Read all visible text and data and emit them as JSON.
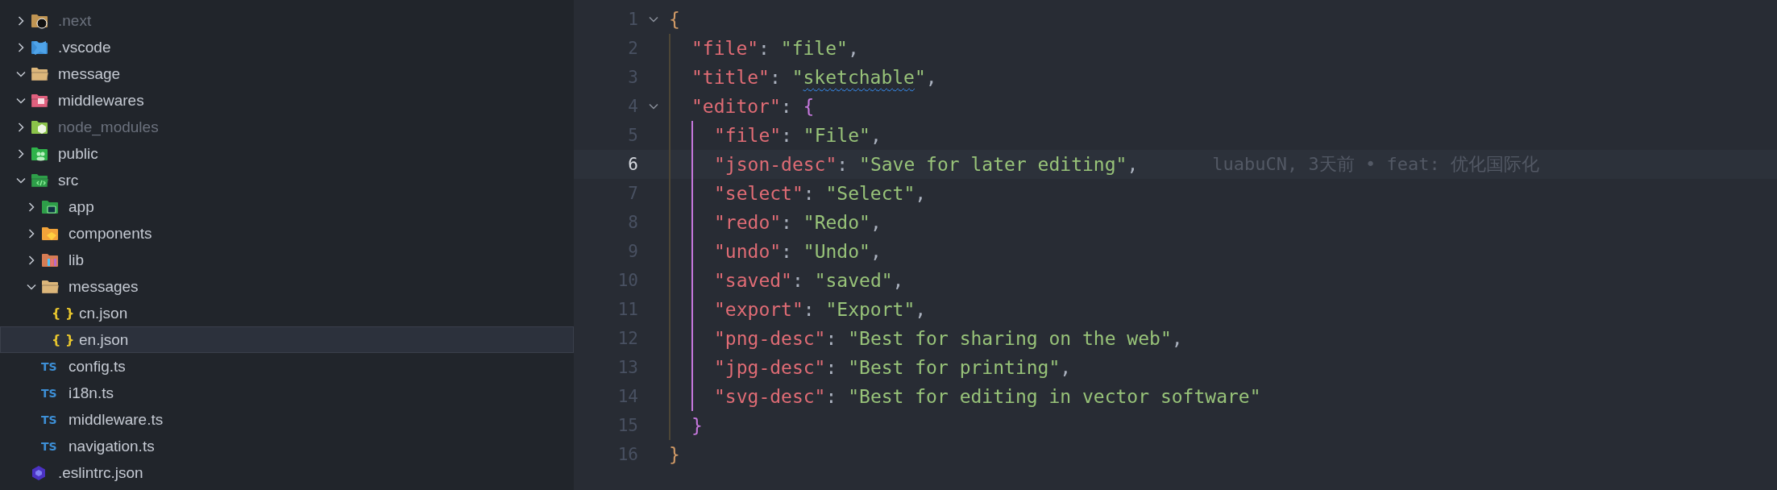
{
  "explorer": {
    "items": [
      {
        "label": ".next",
        "kind": "folder_next",
        "expanded": false,
        "dimmed": true,
        "selected": false
      },
      {
        "label": ".vscode",
        "kind": "folder_vscode",
        "expanded": false,
        "dimmed": false,
        "selected": false
      },
      {
        "label": "message",
        "kind": "folder",
        "expanded": true,
        "dimmed": false,
        "selected": false
      },
      {
        "label": "middlewares",
        "kind": "folder_middleware",
        "expanded": true,
        "dimmed": false,
        "selected": false
      },
      {
        "label": "node_modules",
        "kind": "folder_node",
        "expanded": false,
        "dimmed": true,
        "selected": false
      },
      {
        "label": "public",
        "kind": "folder_public",
        "expanded": false,
        "dimmed": false,
        "selected": false
      },
      {
        "label": "src",
        "kind": "folder_src",
        "expanded": true,
        "dimmed": false,
        "selected": false,
        "children": [
          {
            "label": "app",
            "kind": "folder_app",
            "expanded": false,
            "dimmed": false,
            "selected": false
          },
          {
            "label": "components",
            "kind": "folder_components",
            "expanded": false,
            "dimmed": false,
            "selected": false
          },
          {
            "label": "lib",
            "kind": "folder_lib",
            "expanded": false,
            "dimmed": false,
            "selected": false
          },
          {
            "label": "messages",
            "kind": "folder",
            "expanded": true,
            "dimmed": false,
            "selected": false,
            "children": [
              {
                "label": "cn.json",
                "kind": "json",
                "badge": "{ }",
                "dimmed": false,
                "selected": false
              },
              {
                "label": "en.json",
                "kind": "json",
                "badge": "{ }",
                "dimmed": false,
                "selected": true
              }
            ]
          },
          {
            "label": "config.ts",
            "kind": "ts",
            "badge": "TS",
            "dimmed": false,
            "selected": false
          },
          {
            "label": "i18n.ts",
            "kind": "ts",
            "badge": "TS",
            "dimmed": false,
            "selected": false
          },
          {
            "label": "middleware.ts",
            "kind": "ts",
            "badge": "TS",
            "dimmed": false,
            "selected": false
          },
          {
            "label": "navigation.ts",
            "kind": "ts",
            "badge": "TS",
            "dimmed": false,
            "selected": false
          }
        ]
      },
      {
        "label": ".eslintrc.json",
        "kind": "eslint",
        "dimmed": false,
        "selected": false
      }
    ]
  },
  "editor": {
    "lines": [
      {
        "number": "1",
        "current": false,
        "foldable": true,
        "expanded": true,
        "tokens": [
          {
            "kind": "open",
            "text": "{"
          }
        ]
      },
      {
        "number": "2",
        "current": false,
        "tokens": [
          {
            "kind": "key",
            "text": "\"file\""
          },
          {
            "kind": "punct",
            "text": ": "
          },
          {
            "kind": "string",
            "text": "\"file\""
          },
          {
            "kind": "punct",
            "text": ","
          }
        ]
      },
      {
        "number": "3",
        "current": false,
        "tokens": [
          {
            "kind": "key",
            "text": "\"title\""
          },
          {
            "kind": "punct",
            "text": ": "
          },
          {
            "kind": "string",
            "text": "\""
          },
          {
            "kind": "string",
            "text": "sketchable",
            "warning": true
          },
          {
            "kind": "string",
            "text": "\""
          },
          {
            "kind": "punct",
            "text": ","
          }
        ]
      },
      {
        "number": "4",
        "current": false,
        "foldable": true,
        "expanded": true,
        "tokens": [
          {
            "kind": "key",
            "text": "\"editor\""
          },
          {
            "kind": "punct",
            "text": ": "
          },
          {
            "kind": "open",
            "text": "{"
          }
        ]
      },
      {
        "number": "5",
        "current": false,
        "tokens": [
          {
            "kind": "key",
            "text": "\"file\""
          },
          {
            "kind": "punct",
            "text": ": "
          },
          {
            "kind": "string",
            "text": "\"File\""
          },
          {
            "kind": "punct",
            "text": ","
          }
        ]
      },
      {
        "number": "6",
        "current": true,
        "blame": "luabuCN, 3天前 • feat: 优化国际化",
        "tokens": [
          {
            "kind": "key",
            "text": "\"json-desc\""
          },
          {
            "kind": "punct",
            "text": ": "
          },
          {
            "kind": "string",
            "text": "\"Save for later editing\""
          },
          {
            "kind": "punct",
            "text": ","
          }
        ]
      },
      {
        "number": "7",
        "current": false,
        "tokens": [
          {
            "kind": "key",
            "text": "\"select\""
          },
          {
            "kind": "punct",
            "text": ": "
          },
          {
            "kind": "string",
            "text": "\"Select\""
          },
          {
            "kind": "punct",
            "text": ","
          }
        ]
      },
      {
        "number": "8",
        "current": false,
        "tokens": [
          {
            "kind": "key",
            "text": "\"redo\""
          },
          {
            "kind": "punct",
            "text": ": "
          },
          {
            "kind": "string",
            "text": "\"Redo\""
          },
          {
            "kind": "punct",
            "text": ","
          }
        ]
      },
      {
        "number": "9",
        "current": false,
        "tokens": [
          {
            "kind": "key",
            "text": "\"undo\""
          },
          {
            "kind": "punct",
            "text": ": "
          },
          {
            "kind": "string",
            "text": "\"Undo\""
          },
          {
            "kind": "punct",
            "text": ","
          }
        ]
      },
      {
        "number": "10",
        "current": false,
        "tokens": [
          {
            "kind": "key",
            "text": "\"saved\""
          },
          {
            "kind": "punct",
            "text": ": "
          },
          {
            "kind": "string",
            "text": "\"saved\""
          },
          {
            "kind": "punct",
            "text": ","
          }
        ]
      },
      {
        "number": "11",
        "current": false,
        "tokens": [
          {
            "kind": "key",
            "text": "\"export\""
          },
          {
            "kind": "punct",
            "text": ": "
          },
          {
            "kind": "string",
            "text": "\"Export\""
          },
          {
            "kind": "punct",
            "text": ","
          }
        ]
      },
      {
        "number": "12",
        "current": false,
        "tokens": [
          {
            "kind": "key",
            "text": "\"png-desc\""
          },
          {
            "kind": "punct",
            "text": ": "
          },
          {
            "kind": "string",
            "text": "\"Best for sharing on the web\""
          },
          {
            "kind": "punct",
            "text": ","
          }
        ]
      },
      {
        "number": "13",
        "current": false,
        "tokens": [
          {
            "kind": "key",
            "text": "\"jpg-desc\""
          },
          {
            "kind": "punct",
            "text": ": "
          },
          {
            "kind": "string",
            "text": "\"Best for printing\""
          },
          {
            "kind": "punct",
            "text": ","
          }
        ]
      },
      {
        "number": "14",
        "current": false,
        "tokens": [
          {
            "kind": "key",
            "text": "\"svg-desc\""
          },
          {
            "kind": "punct",
            "text": ": "
          },
          {
            "kind": "string",
            "text": "\"Best for editing in vector software\""
          }
        ]
      },
      {
        "number": "15",
        "current": false,
        "tokens": [
          {
            "kind": "close",
            "text": "}"
          }
        ]
      },
      {
        "number": "16",
        "current": false,
        "tokens": [
          {
            "kind": "close",
            "text": "}"
          }
        ]
      }
    ]
  }
}
